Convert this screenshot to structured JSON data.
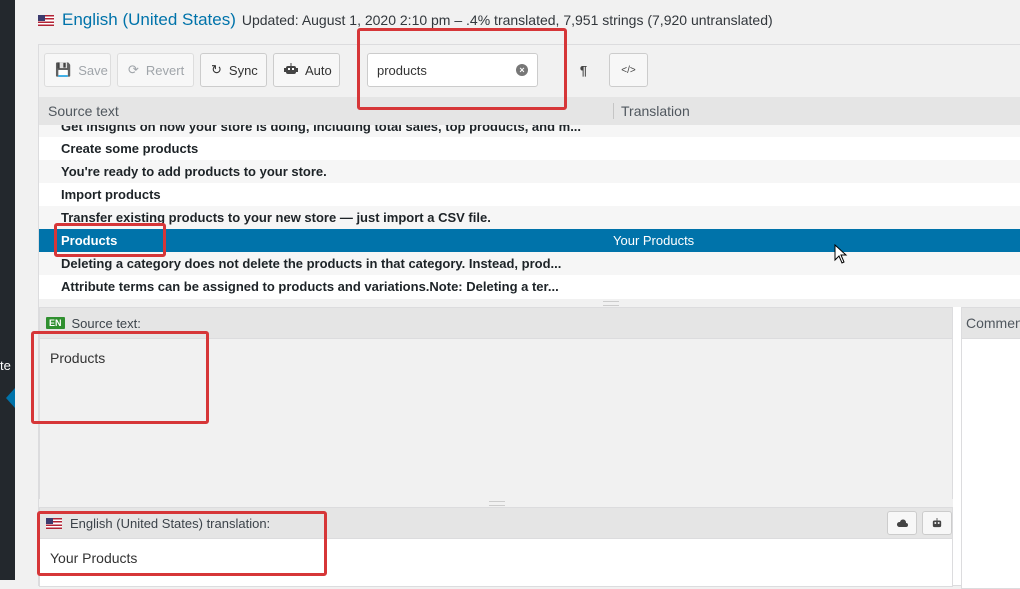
{
  "admin_menu": {
    "partial_label": "te"
  },
  "header": {
    "language": "English (United States)",
    "meta": "Updated: August 1, 2020 2:10 pm – .4% translated, 7,951 strings (7,920 untranslated)"
  },
  "toolbar": {
    "save_label": "Save",
    "revert_label": "Revert",
    "sync_label": "Sync",
    "auto_label": "Auto",
    "search_value": "products",
    "invisibles_glyph": "¶",
    "code_glyph": "</>"
  },
  "columns": {
    "source": "Source text",
    "translation": "Translation"
  },
  "rows": [
    {
      "source": "Get insights on how your store is doing, including total sales, top products, and m...",
      "translation": ""
    },
    {
      "source": "Create some products",
      "translation": ""
    },
    {
      "source": "You're ready to add products to your store.",
      "translation": ""
    },
    {
      "source": "Import products",
      "translation": ""
    },
    {
      "source": "Transfer existing products to your new store — just import a CSV file.",
      "translation": ""
    },
    {
      "source": "Products",
      "translation": "Your Products"
    },
    {
      "source": "Deleting a category does not delete the products in that category. Instead, prod...",
      "translation": ""
    },
    {
      "source": "Attribute terms can be assigned to products and variations.Note: Deleting a ter...",
      "translation": ""
    }
  ],
  "source_panel": {
    "lang_badge": "EN",
    "title": "Source text:",
    "text": "Products"
  },
  "comments_panel": {
    "title": "Commen"
  },
  "translation_panel": {
    "title": "English (United States) translation:",
    "text": "Your Products"
  },
  "colors": {
    "accent": "#0073aa",
    "highlight": "#d63638"
  }
}
